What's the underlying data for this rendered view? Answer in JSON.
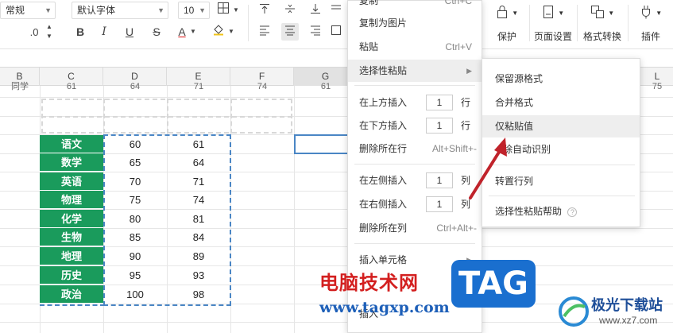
{
  "toolbar": {
    "number_format": "常规",
    "decimal": ".0",
    "font_name": "默认字体",
    "font_size": "10",
    "bold": "B",
    "italic": "I",
    "underline": "U",
    "strike": "S",
    "font_color_glyph": "A",
    "protect_label": "保护",
    "page_setup_label": "页面设置",
    "format_convert_label": "格式转换",
    "plugin_label": "插件"
  },
  "columns": [
    "B",
    "C",
    "D",
    "E",
    "F",
    "G",
    "L"
  ],
  "partial_row": [
    "同学",
    "61",
    "64",
    "71",
    "74",
    "61",
    "75"
  ],
  "table": [
    {
      "subject": "语文",
      "d": "60",
      "e": "61"
    },
    {
      "subject": "数学",
      "d": "65",
      "e": "64"
    },
    {
      "subject": "英语",
      "d": "70",
      "e": "71"
    },
    {
      "subject": "物理",
      "d": "75",
      "e": "74"
    },
    {
      "subject": "化学",
      "d": "80",
      "e": "81"
    },
    {
      "subject": "生物",
      "d": "85",
      "e": "84"
    },
    {
      "subject": "地理",
      "d": "90",
      "e": "89"
    },
    {
      "subject": "历史",
      "d": "95",
      "e": "93"
    },
    {
      "subject": "政治",
      "d": "100",
      "e": "98"
    }
  ],
  "context_menu": {
    "copy": "复制",
    "copy_shortcut": "Ctrl+C",
    "copy_as_image": "复制为图片",
    "paste": "粘贴",
    "paste_shortcut": "Ctrl+V",
    "paste_special": "选择性粘贴",
    "insert_above": "在上方插入",
    "insert_above_count": "1",
    "insert_above_unit": "行",
    "insert_below": "在下方插入",
    "insert_below_count": "1",
    "insert_below_unit": "行",
    "delete_row": "删除所在行",
    "delete_row_shortcut": "Alt+Shift+-",
    "insert_left": "在左侧插入",
    "insert_left_count": "1",
    "insert_left_unit": "列",
    "insert_right": "在右侧插入",
    "insert_right_count": "1",
    "insert_right_unit": "列",
    "delete_col": "删除所在列",
    "delete_col_shortcut": "Ctrl+Alt+-",
    "insert_cell": "插入单元格",
    "insert_partial": "插入"
  },
  "submenu": {
    "keep_source": "保留源格式",
    "merge_format": "合并格式",
    "values_only": "仅粘贴值",
    "auto_detect": "除自动识别",
    "transpose": "转置行列",
    "help": "选择性粘贴帮助"
  },
  "watermark": {
    "site_cn": "电脑技术网",
    "site_url": "www.tagxp.com",
    "tag": "TAG",
    "jg_name": "极光下载站",
    "jg_url": "www.xz7.com"
  },
  "colors": {
    "accent_green": "#1a9b5c",
    "arrow_red": "#c0232b",
    "selection_blue": "#4a86c5"
  }
}
